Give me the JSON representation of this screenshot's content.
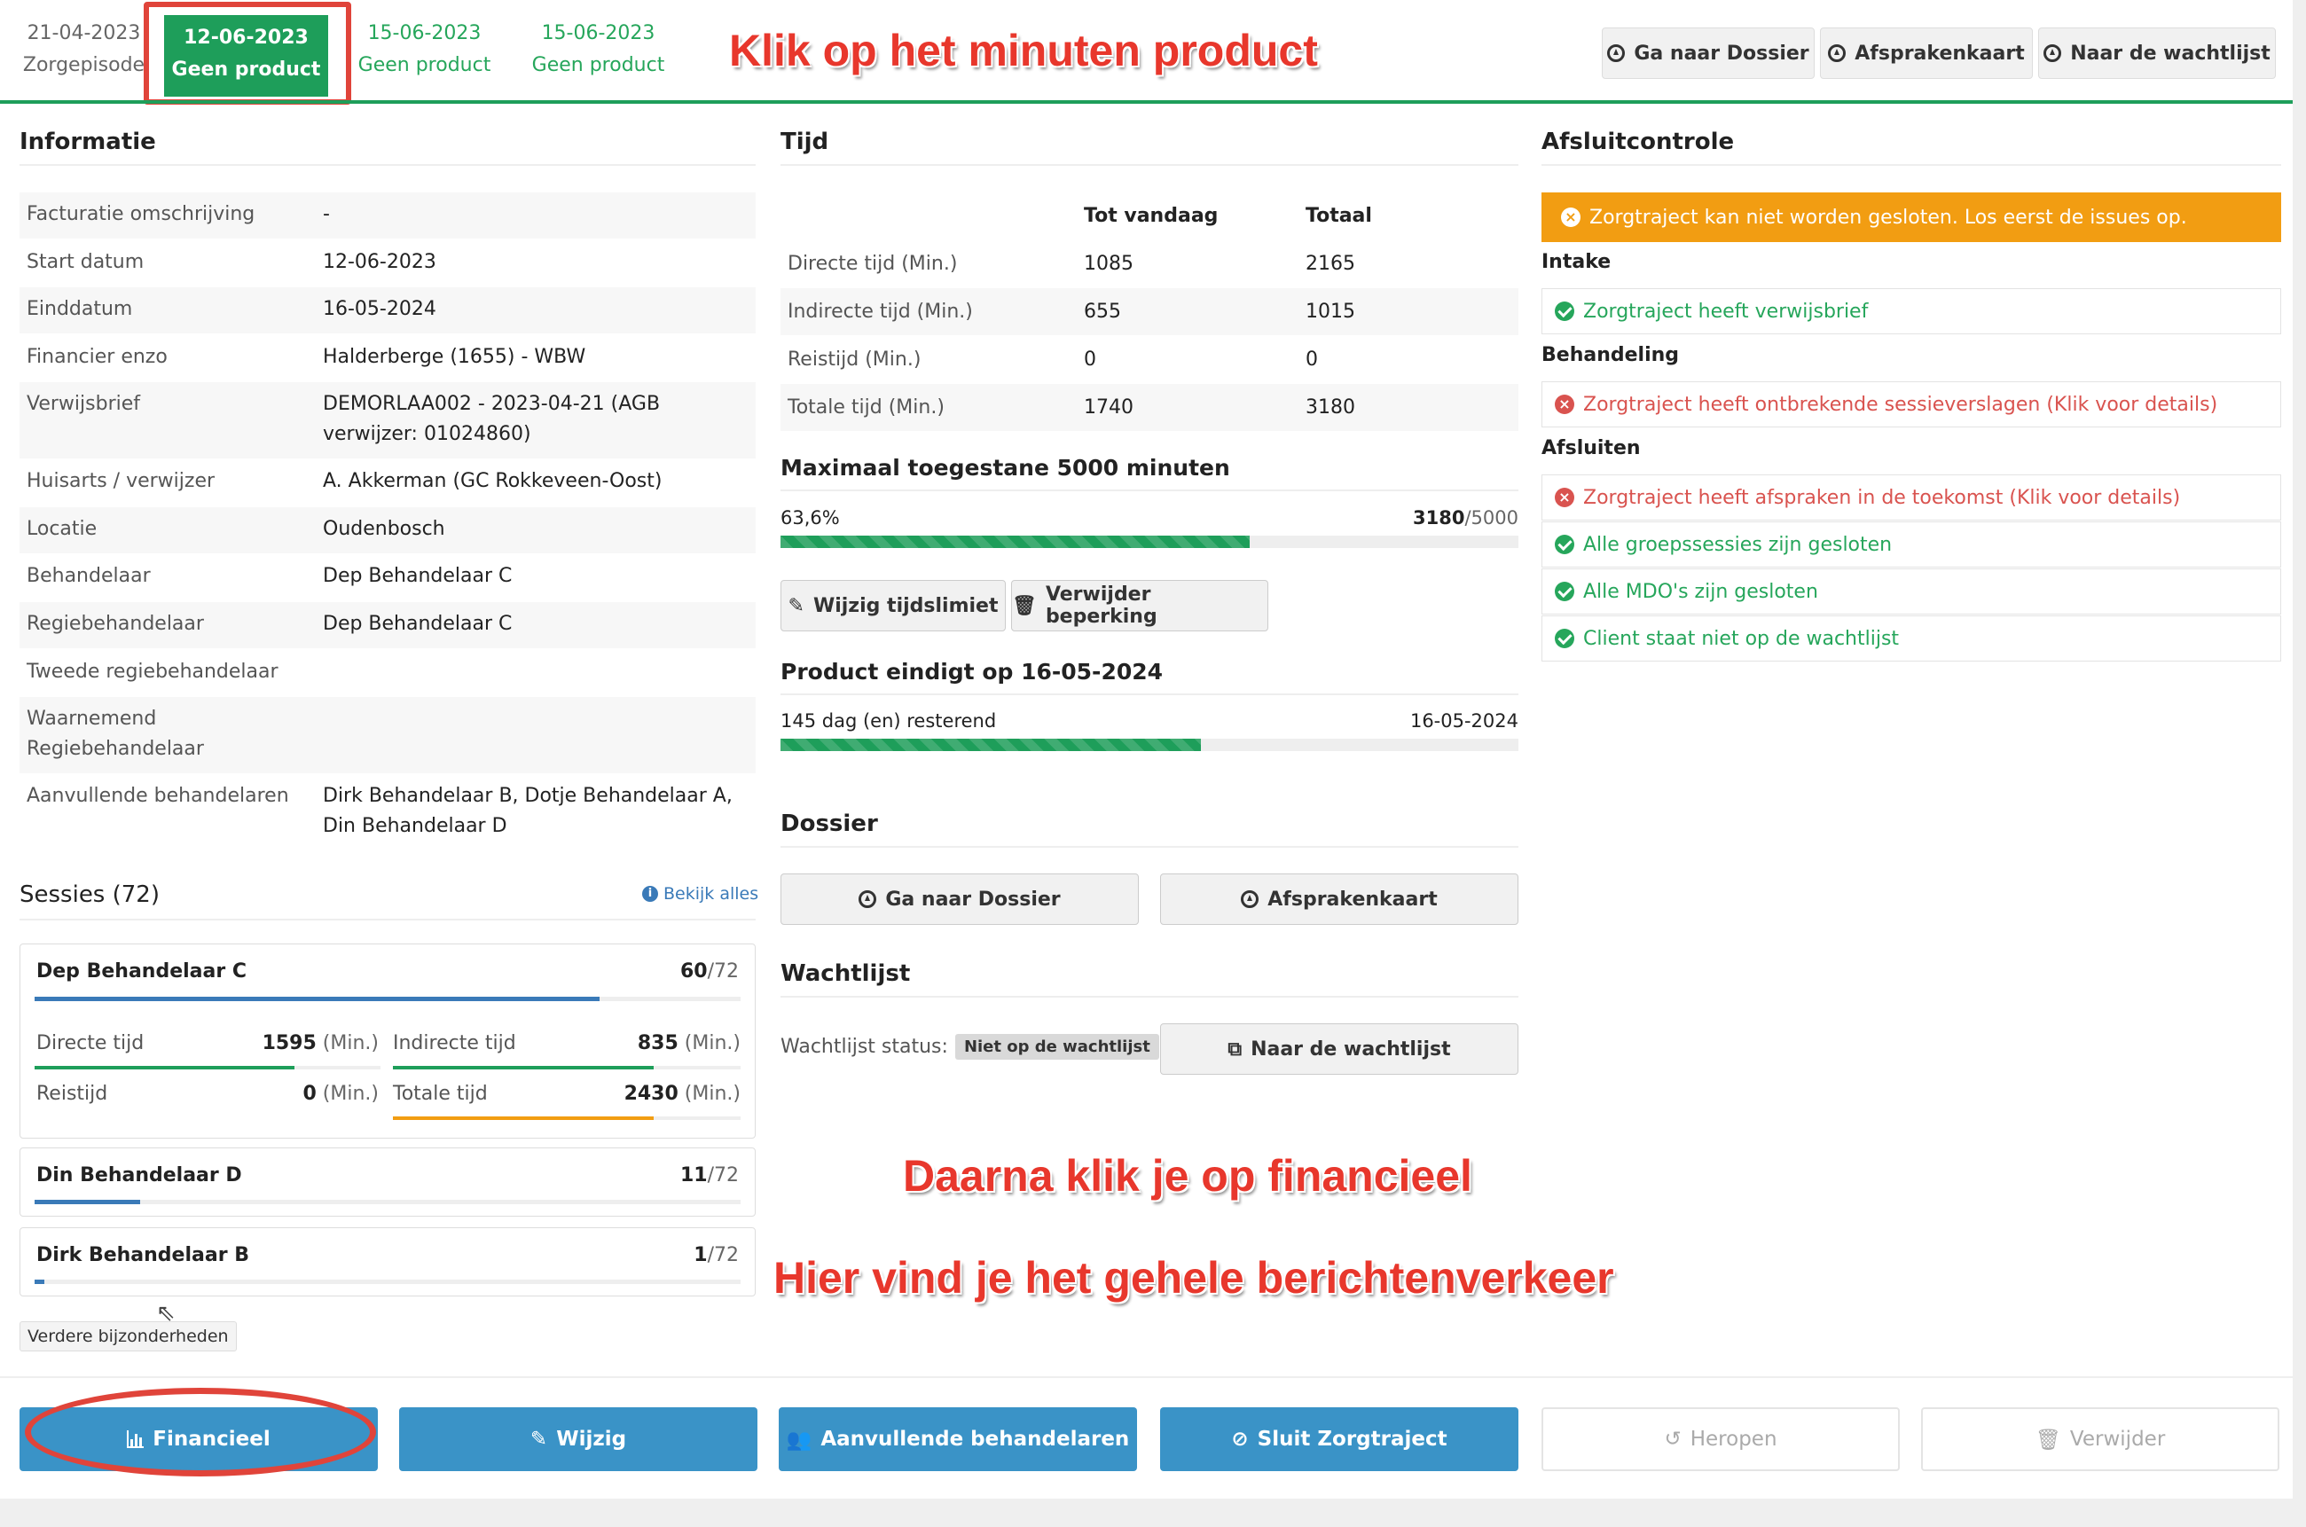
{
  "tabs": [
    {
      "date": "21-04-2023",
      "label": "Zorgepisode"
    },
    {
      "date": "12-06-2023",
      "label": "Geen product"
    },
    {
      "date": "15-06-2023",
      "label": "Geen product"
    },
    {
      "date": "15-06-2023",
      "label": "Geen product"
    }
  ],
  "header_buttons": {
    "dossier": "Ga naar Dossier",
    "afsprakenkaart": "Afsprakenkaart",
    "wachtlijst": "Naar de wachtlijst"
  },
  "informatie": {
    "title": "Informatie",
    "rows": [
      {
        "k": "Facturatie omschrijving",
        "v": "-"
      },
      {
        "k": "Start datum",
        "v": "12-06-2023"
      },
      {
        "k": "Einddatum",
        "v": "16-05-2024"
      },
      {
        "k": "Financier enzo",
        "v": "Halderberge (1655) - WBW"
      },
      {
        "k": "Verwijsbrief",
        "v": "DEMORLAA002 - 2023-04-21 (AGB verwijzer: 01024860)"
      },
      {
        "k": "Huisarts / verwijzer",
        "v": "A. Akkerman (GC Rokkeveen-Oost)"
      },
      {
        "k": "Locatie",
        "v": "Oudenbosch"
      },
      {
        "k": "Behandelaar",
        "v": "Dep Behandelaar C"
      },
      {
        "k": "Regiebehandelaar",
        "v": "Dep Behandelaar C"
      },
      {
        "k": "Tweede regiebehandelaar",
        "v": ""
      },
      {
        "k": "Waarnemend Regiebehandelaar",
        "v": ""
      },
      {
        "k": "Aanvullende behandelaren",
        "v": "Dirk Behandelaar B, Dotje Behandelaar A, Din Behandelaar D"
      }
    ]
  },
  "tijd": {
    "title": "Tijd",
    "col_today": "Tot vandaag",
    "col_total": "Totaal",
    "rows": [
      {
        "k": "Directe tijd (Min.)",
        "today": "1085",
        "total": "2165"
      },
      {
        "k": "Indirecte tijd (Min.)",
        "today": "655",
        "total": "1015"
      },
      {
        "k": "Reistijd (Min.)",
        "today": "0",
        "total": "0"
      },
      {
        "k": "Totale tijd (Min.)",
        "today": "1740",
        "total": "3180"
      }
    ],
    "max_title": "Maximaal toegestane 5000 minuten",
    "max_percent_label": "63,6%",
    "max_used": "3180",
    "max_limit": "/5000",
    "max_fraction": 0.636,
    "btn_wijzig": "Wijzig tijdslimiet",
    "btn_verwijder": "Verwijder beperking",
    "end_title": "Product eindigt op 16-05-2024",
    "days_left": "145 dag (en) resterend",
    "end_date": "16-05-2024",
    "end_fraction": 0.57
  },
  "dossier": {
    "title": "Dossier",
    "btn_dossier": "Ga naar Dossier",
    "btn_afspraken": "Afsprakenkaart"
  },
  "wachtlijst": {
    "title": "Wachtlijst",
    "status_label": "Wachtlijst status:",
    "status_badge": "Niet op de wachtlijst",
    "btn": "Naar de wachtlijst"
  },
  "afsluit": {
    "title": "Afsluitcontrole",
    "warning": "Zorgtraject kan niet worden gesloten. Los eerst de issues op.",
    "intake_label": "Intake",
    "intake": "Zorgtraject heeft verwijsbrief",
    "behandeling_label": "Behandeling",
    "behandeling": "Zorgtraject heeft ontbrekende sessieverslagen (Klik voor details)",
    "afsluiten_label": "Afsluiten",
    "afsluiten": [
      {
        "text": "Zorgtraject heeft afspraken in de toekomst (Klik voor details)",
        "ok": false
      },
      {
        "text": "Alle groepssessies zijn gesloten",
        "ok": true
      },
      {
        "text": "Alle MDO's zijn gesloten",
        "ok": true
      },
      {
        "text": "Client staat niet op de wachtlijst",
        "ok": true
      }
    ]
  },
  "sessies": {
    "title": "Sessies (72)",
    "bekijk": "Bekijk alles",
    "cards": [
      {
        "name": "Dep Behandelaar C",
        "count": "60",
        "of": "/72",
        "fraction": 0.8,
        "direct_label": "Directe tijd",
        "direct_val": "1595",
        "indirect_label": "Indirecte tijd",
        "indirect_val": "835",
        "reis_label": "Reistijd",
        "reis_val": "0",
        "totaal_label": "Totale tijd",
        "totaal_val": "2430",
        "unit": "(Min.)"
      },
      {
        "name": "Din Behandelaar D",
        "count": "11",
        "of": "/72",
        "fraction": 0.15
      },
      {
        "name": "Dirk Behandelaar B",
        "count": "1",
        "of": "/72",
        "fraction": 0.014
      }
    ],
    "verdere": "Verdere bijzonderheden"
  },
  "bottom_buttons": {
    "financieel": "Financieel",
    "wijzig": "Wijzig",
    "aanvullende": "Aanvullende behandelaren",
    "sluit": "Sluit Zorgtraject",
    "heropen": "Heropen",
    "verwijder": "Verwijder"
  },
  "annotations": {
    "a1": "Klik op het minuten product",
    "a2": "Daarna klik je op financieel",
    "a3": "Hier vind je het gehele berichtenverkeer"
  },
  "colors": {
    "green": "#1e9e5a",
    "blue": "#3a93c7",
    "orange": "#f29d12",
    "red": "#d9534f",
    "annotation": "#e8372c"
  }
}
